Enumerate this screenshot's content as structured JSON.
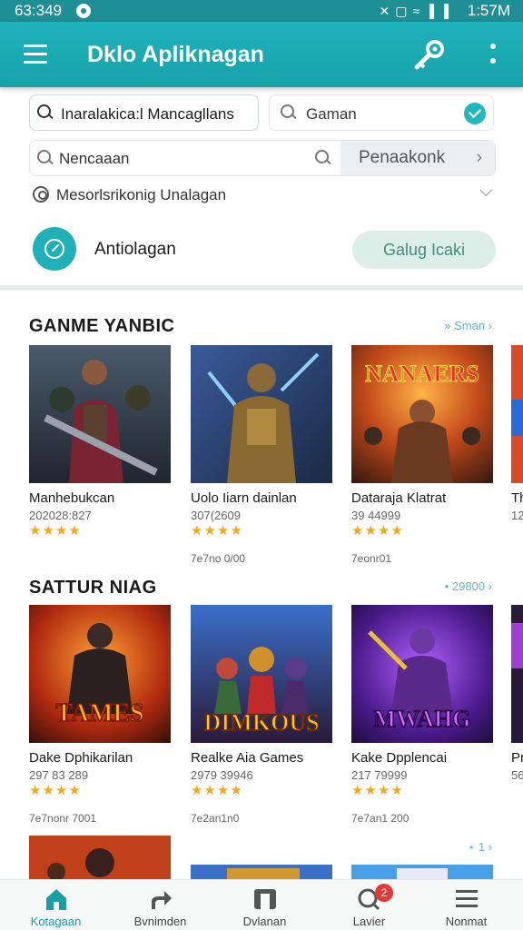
{
  "status_bar": {
    "time_left": "63:349",
    "time_right": "1:57M"
  },
  "app_bar": {
    "title": "Dklo Apliknagan"
  },
  "search_primary": {
    "value": "Inaralakica:l Mancagllans"
  },
  "search_secondary": {
    "value": "Gaman"
  },
  "search_tertiary": {
    "value": "Nencaaan",
    "button_label": "Penaakonk"
  },
  "sort_row": {
    "label": "Mesorlsrikonig Unalagan"
  },
  "app_row": {
    "label": "Antiolagan",
    "button_label": "Galug Icaki"
  },
  "sections": [
    {
      "title": "GANME YANBIC",
      "link": "» Sman ›",
      "items": [
        {
          "name": "Manhebukcan",
          "meta": "202028:827",
          "rating": 4,
          "stars": "★★★★",
          "image_title": "",
          "icon": "warrior-art"
        },
        {
          "name": "Uolo Iiarn dainlan",
          "meta": "307(2609",
          "rating": 4,
          "stars": "★★★★",
          "image_title": "",
          "icon": "golden-knight-art"
        },
        {
          "name": "Dataraja Klatrat",
          "meta": "39 44999",
          "rating": 4,
          "stars": "★★★★",
          "image_title": "NANAERS",
          "icon": "battle-art"
        },
        {
          "name": "Th",
          "meta": "12",
          "rating": 0,
          "stars": "",
          "image_title": "",
          "icon": "partial-art"
        }
      ],
      "extras": [
        "7e7no 0/00",
        "7eonr01"
      ]
    },
    {
      "title": "SATTUR NIAG",
      "link": "• 29800 ›",
      "items": [
        {
          "name": "Dake Dphikarilan",
          "meta": "297 83 289",
          "rating": 4,
          "stars": "★★★★",
          "image_title": "TAMES",
          "icon": "dark-knight-art"
        },
        {
          "name": "Realke Aia Games",
          "meta": "2979 39946",
          "rating": 4,
          "stars": "★★★★",
          "image_title": "DIMKOUS",
          "icon": "heroes-art"
        },
        {
          "name": "Kake Dpplencai",
          "meta": "217 79999",
          "rating": 4,
          "stars": "★★★★",
          "image_title": "MWAHG",
          "icon": "mage-art"
        },
        {
          "name": "Pr",
          "meta": "56",
          "rating": 0,
          "stars": "",
          "image_title": "",
          "icon": "partial-art"
        }
      ],
      "extras": [
        "7e7nonr 7001",
        "7e2an1n0",
        "7e7an1 200"
      ]
    }
  ],
  "third_section": {
    "link": "⋆ 1 ›"
  },
  "bottom_nav": [
    {
      "label": "Kotagaan",
      "icon": "home-icon",
      "active": true
    },
    {
      "label": "Bvnimden",
      "icon": "share-icon",
      "active": false
    },
    {
      "label": "Dvlanan",
      "icon": "library-icon",
      "active": false
    },
    {
      "label": "Lavier",
      "icon": "chat-icon",
      "active": false,
      "badge": "2"
    },
    {
      "label": "Nonmat",
      "icon": "menu-icon",
      "active": false
    }
  ],
  "colors": {
    "primary": "#1fb3bb",
    "accent_star": "#f2a81d",
    "badge": "#e53935"
  }
}
